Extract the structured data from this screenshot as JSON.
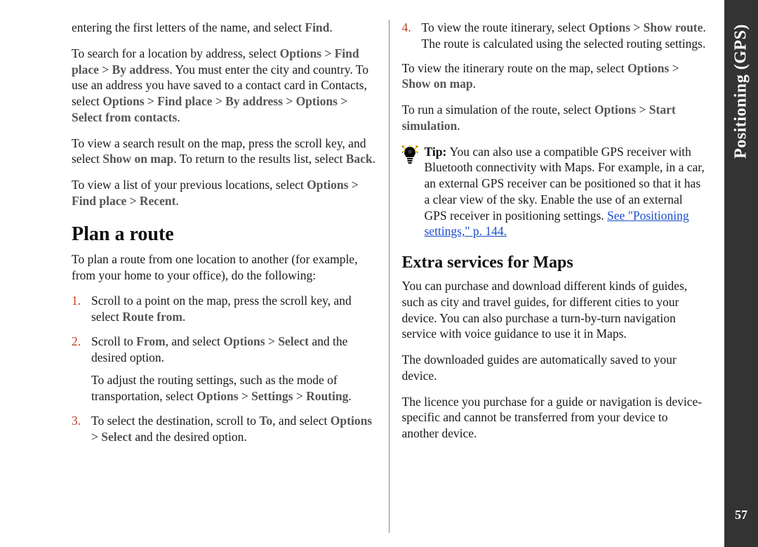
{
  "sideTab": {
    "label": "Positioning (GPS)",
    "pageNumber": "57"
  },
  "left": {
    "p1_a": "entering the first letters of the name, and select ",
    "p1_find": "Find",
    "p1_b": ".",
    "p2_a": "To search for a location by address, select ",
    "p2_opt1": "Options",
    "p2_gt1": " > ",
    "p2_fp": "Find place",
    "p2_gt2": " > ",
    "p2_ba": "By address",
    "p2_b": ". You must enter the city and country. To use an address you have saved to a contact card in Contacts, select ",
    "p2_opt2": "Options",
    "p2_gt3": " > ",
    "p2_fp2": "Find place",
    "p2_gt4": " > ",
    "p2_ba2": "By address",
    "p2_gt5": " > ",
    "p2_opt3": "Options",
    "p2_gt6": " > ",
    "p2_sfc": "Select from contacts",
    "p2_c": ".",
    "p3_a": "To view a search result on the map, press the scroll key, and select ",
    "p3_som": "Show on map",
    "p3_b": ". To return to the results list, select ",
    "p3_back": "Back",
    "p3_c": ".",
    "p4_a": "To view a list of your previous locations, select ",
    "p4_opt": "Options",
    "p4_gt1": " > ",
    "p4_fp": "Find place",
    "p4_gt2": " > ",
    "p4_rec": "Recent",
    "p4_b": ".",
    "h2": "Plan a route",
    "p5": "To plan a route from one location to another (for example, from your home to your office), do the following:",
    "li1_num": "1.",
    "li1_a": "Scroll to a point on the map, press the scroll key, and select ",
    "li1_rf": "Route from",
    "li1_b": ".",
    "li2_num": "2.",
    "li2_a": "Scroll to ",
    "li2_from": "From",
    "li2_b": ", and select ",
    "li2_opt": "Options",
    "li2_gt": " > ",
    "li2_sel": "Select",
    "li2_c": " and the desired option.",
    "li2_sub_a": "To adjust the routing settings, such as the mode of transportation, select ",
    "li2_sub_opt": "Options",
    "li2_sub_gt1": " > ",
    "li2_sub_set": "Settings",
    "li2_sub_gt2": " > ",
    "li2_sub_rt": "Routing",
    "li2_sub_b": ".",
    "li3_num": "3.",
    "li3_a": "To select the destination, scroll to ",
    "li3_to": "To",
    "li3_b": ", and select ",
    "li3_opt": "Options",
    "li3_gt": " > ",
    "li3_sel": "Select",
    "li3_c": " and the desired option."
  },
  "right": {
    "li4_num": "4.",
    "li4_a": "To view the route itinerary, select ",
    "li4_opt": "Options",
    "li4_gt": " > ",
    "li4_sr": "Show route",
    "li4_b": ". The route is calculated using the selected routing settings.",
    "p6_a": "To view the itinerary route on the map, select ",
    "p6_opt": "Options",
    "p6_gt": " > ",
    "p6_som": "Show on map",
    "p6_b": ".",
    "p7_a": "To run a simulation of the route, select ",
    "p7_opt": "Options",
    "p7_gt": " > ",
    "p7_ss": "Start simulation",
    "p7_b": ".",
    "tip_label": "Tip: ",
    "tip_a": "You can also use a compatible GPS receiver with Bluetooth connectivity with Maps. For example, in a car, an external GPS receiver can be positioned so that it has a clear view of the sky. Enable the use of an external GPS receiver in positioning settings. ",
    "tip_link": "See \"Positioning settings,\" p. 144.",
    "h2": "Extra services for Maps",
    "p8": "You can purchase and download different kinds of guides, such as city and travel guides, for different cities to your device. You can also purchase a turn-by-turn navigation service with voice guidance to use it in Maps.",
    "p9": "The downloaded guides are automatically saved to your device.",
    "p10": "The licence you purchase for a guide or navigation is device-specific and cannot be transferred from your device to another device."
  }
}
